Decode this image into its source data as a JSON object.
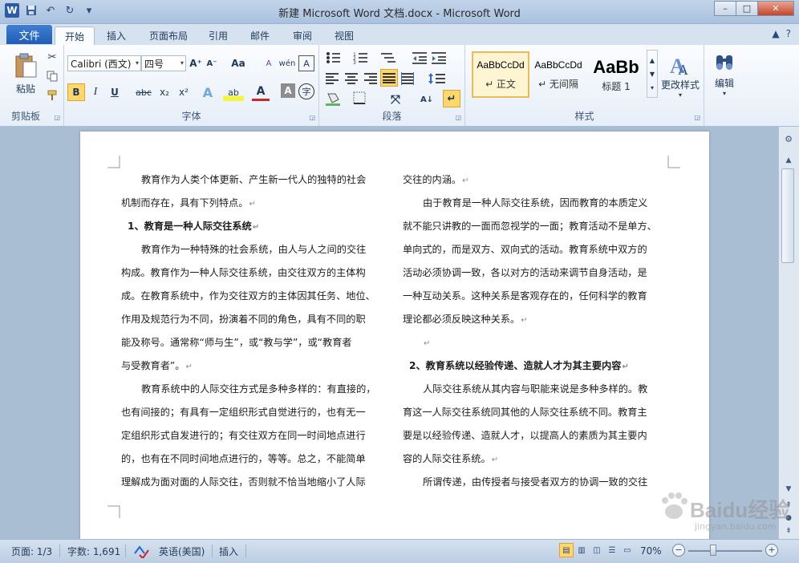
{
  "window": {
    "title": "新建 Microsoft Word 文档.docx  -  Microsoft Word",
    "controls": {
      "minimize": "–",
      "maximize": "□",
      "close": "✕"
    }
  },
  "qat": {
    "logo": "W",
    "save": "💾",
    "undo": "↶",
    "redo": "↻",
    "more": "▾"
  },
  "tabs": {
    "file": "文件",
    "items": [
      "开始",
      "插入",
      "页面布局",
      "引用",
      "邮件",
      "审阅",
      "视图"
    ],
    "active": "开始",
    "right": {
      "collapse": "▲",
      "help": "?"
    }
  },
  "ribbon": {
    "clipboard": {
      "paste": "粘贴",
      "label": "剪贴板"
    },
    "font": {
      "name": "Calibri (西文)",
      "size": "四号",
      "grow": "A⁺",
      "shrink": "A⁻",
      "case": "Aa",
      "clear": "A",
      "phonetic": "wén",
      "border": "A",
      "bold": "B",
      "italic": "I",
      "underline": "U",
      "strike": "abc",
      "sub": "x₂",
      "sup": "x²",
      "effects": "A",
      "highlight": "ab",
      "color": "A",
      "shading": "A",
      "enclose": "字",
      "label": "字体"
    },
    "paragraph": {
      "label": "段落",
      "sort": "A↓",
      "marks": "↵"
    },
    "styles": {
      "items": [
        {
          "sample": "AaBbCcDd",
          "name": "↵ 正文"
        },
        {
          "sample": "AaBbCcDd",
          "name": "↵ 无间隔"
        },
        {
          "sample": "AaBb",
          "name": "标题 1"
        }
      ],
      "change": "更改样式",
      "label": "样式"
    },
    "editing": {
      "label": "编辑"
    }
  },
  "document": {
    "left_column": [
      {
        "text": "教育作为人类个体更新、产生新一代人的独特的社会",
        "style": "ind"
      },
      {
        "text": "机制而存在，具有下列特点。",
        "style": "",
        "mark": true
      },
      {
        "text": "1、教育是一种人际交往系统",
        "style": "bold h",
        "mark": true
      },
      {
        "text": "教育作为一种特殊的社会系统，由人与人之间的交往",
        "style": "ind"
      },
      {
        "text": "构成。教育作为一种人际交往系统，由交往双方的主体构",
        "style": ""
      },
      {
        "text": "成。在教育系统中，作为交往双方的主体因其任务、地位、",
        "style": ""
      },
      {
        "text": "作用及规范行为不同，扮演着不同的角色，具有不同的职",
        "style": ""
      },
      {
        "text": "能及称号。通常称“师与生”，或“教与学”，或“教育者",
        "style": ""
      },
      {
        "text": "与受教育者”。",
        "style": "",
        "mark": true
      },
      {
        "text": "教育系统中的人际交往方式是多种多样的：有直接的，",
        "style": "ind"
      },
      {
        "text": "也有间接的；有具有一定组织形式自觉进行的，也有无一",
        "style": ""
      },
      {
        "text": "定组织形式自发进行的；有交往双方在同一时间地点进行",
        "style": ""
      },
      {
        "text": "的，也有在不同时间地点进行的，等等。总之，不能简单",
        "style": ""
      },
      {
        "text": "理解成为面对面的人际交往，否则就不恰当地缩小了人际",
        "style": ""
      }
    ],
    "right_column": [
      {
        "text": "交往的内涵。",
        "style": "",
        "mark": true
      },
      {
        "text": "由于教育是一种人际交往系统，因而教育的本质定义",
        "style": "ind"
      },
      {
        "text": "就不能只讲教的一面而忽视学的一面；教育活动不是单方、",
        "style": ""
      },
      {
        "text": "单向式的，而是双方、双向式的活动。教育系统中双方的",
        "style": ""
      },
      {
        "text": "活动必须协调一致，各以对方的活动来调节自身活动，是",
        "style": ""
      },
      {
        "text": "一种互动关系。这种关系是客观存在的，任何科学的教育",
        "style": ""
      },
      {
        "text": "理论都必须反映这种关系。",
        "style": "",
        "mark": true
      },
      {
        "text": "",
        "style": "ind",
        "mark": true
      },
      {
        "text": "2、教育系统以经验传递、造就人才为其主要内容",
        "style": "bold h",
        "mark": true
      },
      {
        "text": "人际交往系统从其内容与职能来说是多种多样的。教",
        "style": "ind"
      },
      {
        "text": "育这一人际交往系统同其他的人际交往系统不同。教育主",
        "style": ""
      },
      {
        "text": "要是以经验传递、造就人才，以提高人的素质为其主要内",
        "style": ""
      },
      {
        "text": "容的人际交往系统。",
        "style": "",
        "mark": true
      },
      {
        "text": "所谓传递，由传授者与接受者双方的协调一致的交往",
        "style": "ind"
      }
    ],
    "paragraph_mark": "↵"
  },
  "statusbar": {
    "page": "页面: 1/3",
    "words": "字数: 1,691",
    "language": "英语(美国)",
    "mode": "插入",
    "zoom": "70%",
    "zoom_level": 0.7
  },
  "watermark": {
    "text": "Baidu经验",
    "sub": "jingyan.baidu.com"
  }
}
